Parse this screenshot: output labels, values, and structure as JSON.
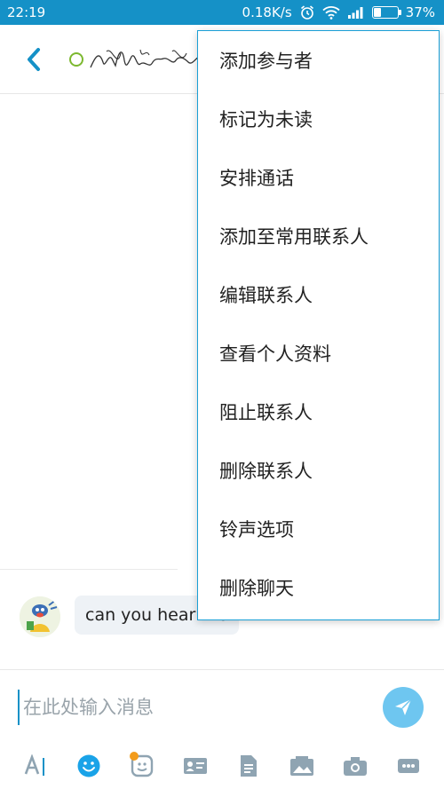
{
  "status_bar": {
    "time": "22:19",
    "net_speed": "0.18K/s",
    "battery_percent": "37%",
    "battery_level": 0.37
  },
  "header": {
    "back_icon": "chevron-left-icon",
    "presence_color": "#7cb82f"
  },
  "messages": [
    {
      "text": "can you hear me"
    }
  ],
  "composer": {
    "placeholder": "在此处输入消息",
    "toolbar_icons": [
      "font-icon",
      "emoji-icon",
      "sticker-icon",
      "contact-card-icon",
      "file-icon",
      "photo-icon",
      "camera-icon",
      "more-icon"
    ]
  },
  "menu": {
    "items": [
      {
        "label": "添加参与者"
      },
      {
        "label": "标记为未读"
      },
      {
        "label": "安排通话"
      },
      {
        "label": "添加至常用联系人"
      },
      {
        "label": "编辑联系人"
      },
      {
        "label": "查看个人资料"
      },
      {
        "label": "阻止联系人"
      },
      {
        "label": "删除联系人"
      },
      {
        "label": "铃声选项"
      },
      {
        "label": "删除聊天"
      }
    ]
  },
  "colors": {
    "status_bar": "#1591c7",
    "accent": "#1a9fd6",
    "send_button": "#6ec6f0",
    "badge": "#f39c1b"
  }
}
